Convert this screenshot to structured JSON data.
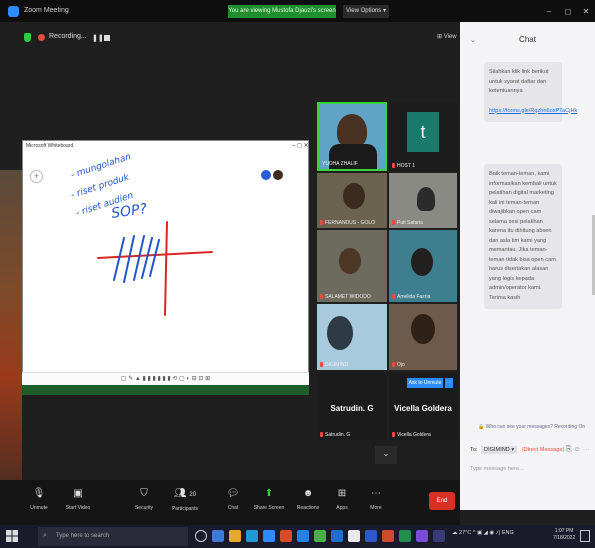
{
  "window": {
    "app_title": "Zoom Meeting",
    "share_banner": "You are viewing Mustofa Djauzi's screen",
    "view_options": "View Options ▾",
    "minimize": "–",
    "maximize": "◻",
    "close": "✕",
    "view_button": "⊞ View"
  },
  "recording": {
    "label": "Recording..."
  },
  "whiteboard": {
    "title": "Microsoft Whiteboard",
    "ink_lines": [
      "- mungolahan",
      "- riset produk",
      "- riset audien",
      "SOP?"
    ],
    "toolbar_glyphs": "▢ ✎ ▲ ▮ ▮ ▮ ▮ ▮ ▮ ⟲ ▢ ◐ ⊟ ⊡ ⊞"
  },
  "gallery": {
    "tiles": [
      {
        "name": "YUDHA ZHALIF",
        "muted": false
      },
      {
        "name": "HOST 1",
        "initial": "t",
        "muted": true
      },
      {
        "name": "FERNANDUS - GOLO",
        "muted": true
      },
      {
        "name": "Puti Safaria",
        "muted": true
      },
      {
        "name": "SALAMET WIDODO",
        "muted": true
      },
      {
        "name": "Amelida Fazria",
        "muted": true
      },
      {
        "name": "DIGIMIND",
        "muted": true
      },
      {
        "name": "Ojo",
        "muted": true
      }
    ],
    "name_tiles": [
      {
        "display": "Satrudin. G",
        "label": "Satrudin. G",
        "muted": true
      },
      {
        "display": "Vicella Goldera",
        "label": "Vicella Goldera",
        "muted": true
      }
    ],
    "add_to_unmute": "Ask to Unmute",
    "scroll_down": "⌄"
  },
  "chat": {
    "title": "Chat",
    "collapse": "⌄",
    "messages": [
      {
        "text": "Silahkan klik link berikut untuk syarat daftar dan ketentuannya",
        "link": "https://forms.gle/Rqzhn6oxPTaCjHk"
      },
      {
        "text": "Baik teman-teman, kami informasikan kembali untuk pelatihan digital marketing kali ini teman-teman diwajibkan open cam selama sesi pelatihan karena itu dihitung absen dan asla tim kami yang memantau. Jika teman-teman tidak bisa open cam harus disertakan alasan yang logis kepada admin/operator kami. Terima kasih"
      }
    ],
    "notice": "🔒 Who can see your messages? Recording On",
    "to_label": "To:",
    "to_target": "DIGIMIND ▾",
    "to_dm": "(Direct Message)",
    "file_icon": "⎘ ☺ ⋯",
    "input_placeholder": "Type message here..."
  },
  "toolbar": {
    "unmute": "Unmute",
    "start_video": "Start Video",
    "security": "Security",
    "participants": "Participants",
    "participants_count": "20",
    "chat": "Chat",
    "share_screen": "Share Screen",
    "reactions": "Reactions",
    "apps": "Apps",
    "more": "More",
    "end": "End"
  },
  "taskbar": {
    "search_placeholder": "Type here to search",
    "tray": "☁ 27°C  ^ ▣ ◢ ◉ ♪) ENG",
    "time": "1:07 PM",
    "date": "7/18/2022"
  },
  "colors": {
    "zoom_blue": "#2d8cff",
    "share_green": "#1f8e2f",
    "end_red": "#d93025",
    "ink_blue": "#2056c8",
    "ink_red": "#d92626"
  }
}
